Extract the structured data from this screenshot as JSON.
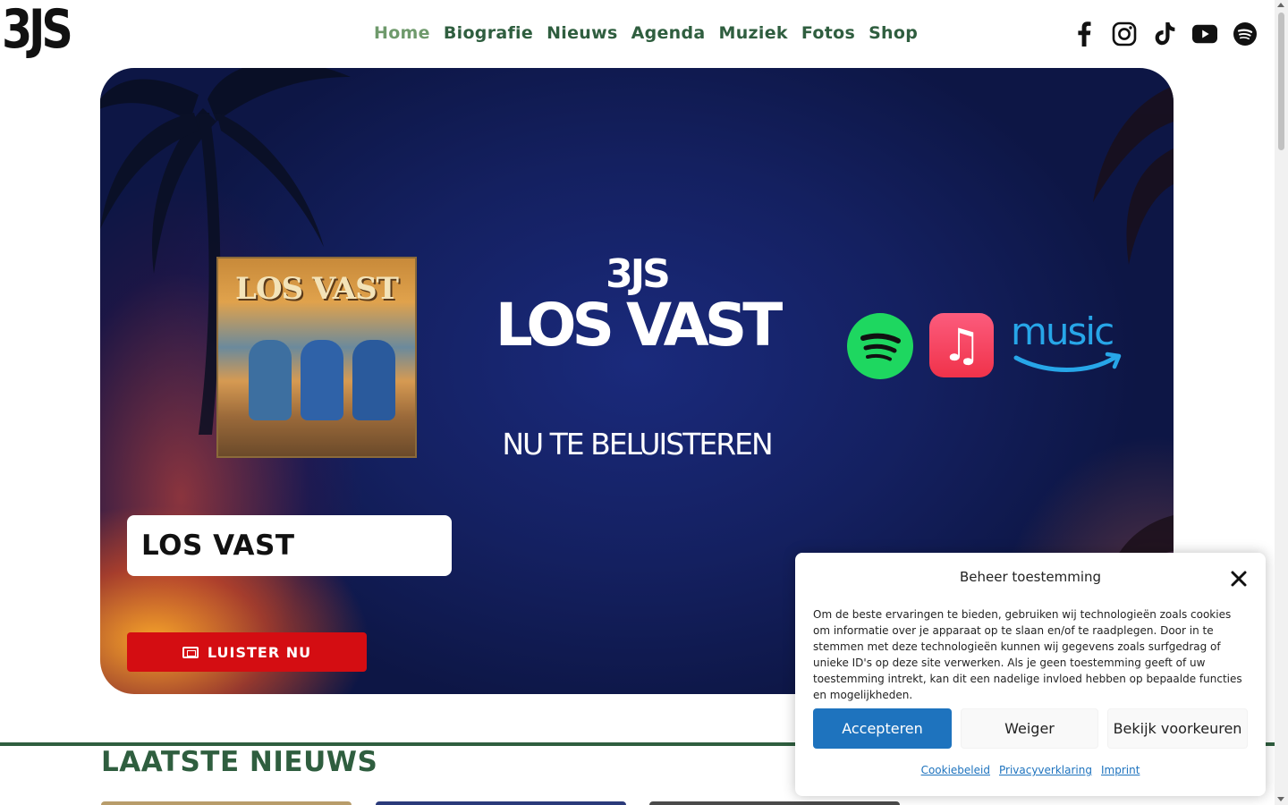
{
  "header": {
    "logo_text": "3JS",
    "nav": [
      {
        "label": "Home",
        "active": true
      },
      {
        "label": "Biografie"
      },
      {
        "label": "Nieuws"
      },
      {
        "label": "Agenda"
      },
      {
        "label": "Muziek"
      },
      {
        "label": "Fotos"
      },
      {
        "label": "Shop"
      }
    ],
    "socials": [
      "facebook-icon",
      "instagram-icon",
      "tiktok-icon",
      "youtube-icon",
      "spotify-icon"
    ]
  },
  "hero": {
    "album_cover_title": "LOS VAST",
    "brand": "3JS",
    "title": "LOS VAST",
    "subtitle": "NU TE BELUISTEREN",
    "streaming": [
      "spotify-logo",
      "apple-music-logo",
      "amazon-music-logo"
    ],
    "amazon_word": "music",
    "label": "LOS VAST",
    "cta_label": "LUISTER NU"
  },
  "news": {
    "heading": "LAATSTE NIEUWS"
  },
  "consent": {
    "title": "Beheer toestemming",
    "body": "Om de beste ervaringen te bieden, gebruiken wij technologieën zoals cookies om informatie over je apparaat op te slaan en/of te raadplegen. Door in te stemmen met deze technologieën kunnen wij gegevens zoals surfgedrag of unieke ID's op deze site verwerken. Als je geen toestemming geeft of uw toestemming intrekt, kan dit een nadelige invloed hebben op bepaalde functies en mogelijkheden.",
    "accept_label": "Accepteren",
    "deny_label": "Weiger",
    "prefs_label": "Bekijk voorkeuren",
    "links": [
      "Cookiebeleid",
      "Privacyverklaring",
      "Imprint"
    ]
  },
  "colors": {
    "nav_green": "#2f5e3f",
    "nav_active": "#6f9a6c",
    "cta_red": "#d40d12",
    "accept_blue": "#1e73be"
  }
}
